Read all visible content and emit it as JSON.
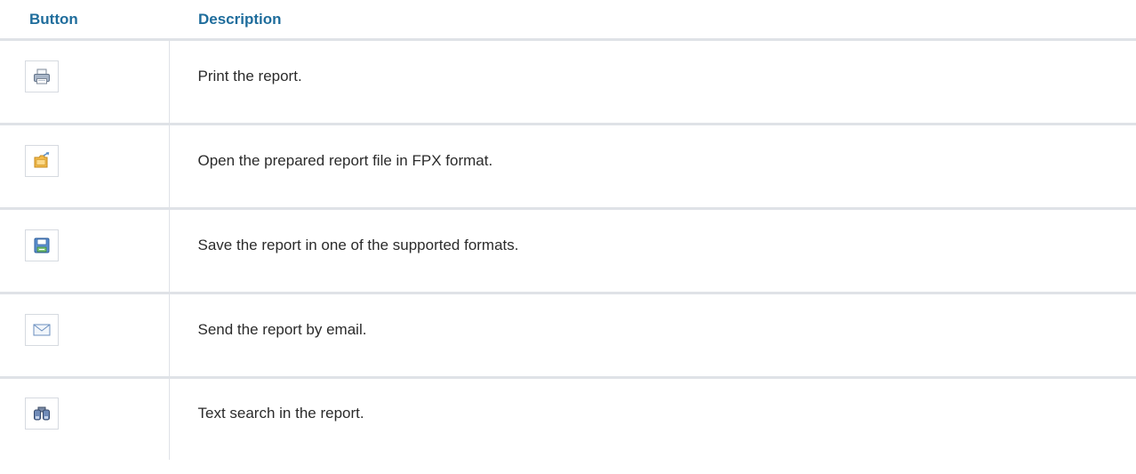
{
  "table": {
    "headers": {
      "button": "Button",
      "description": "Description"
    },
    "rows": [
      {
        "icon": "printer-icon",
        "description": "Print the report."
      },
      {
        "icon": "open-folder-icon",
        "description": "Open the prepared report file in FPX format."
      },
      {
        "icon": "save-floppy-icon",
        "description": "Save the report in one of the supported formats."
      },
      {
        "icon": "email-envelope-icon",
        "description": "Send the report by email."
      },
      {
        "icon": "binoculars-search-icon",
        "description": "Text search in the report."
      }
    ]
  },
  "colors": {
    "header_text": "#1f6d9c",
    "divider": "#dfe2e7",
    "body_text": "#2b2b2b"
  }
}
